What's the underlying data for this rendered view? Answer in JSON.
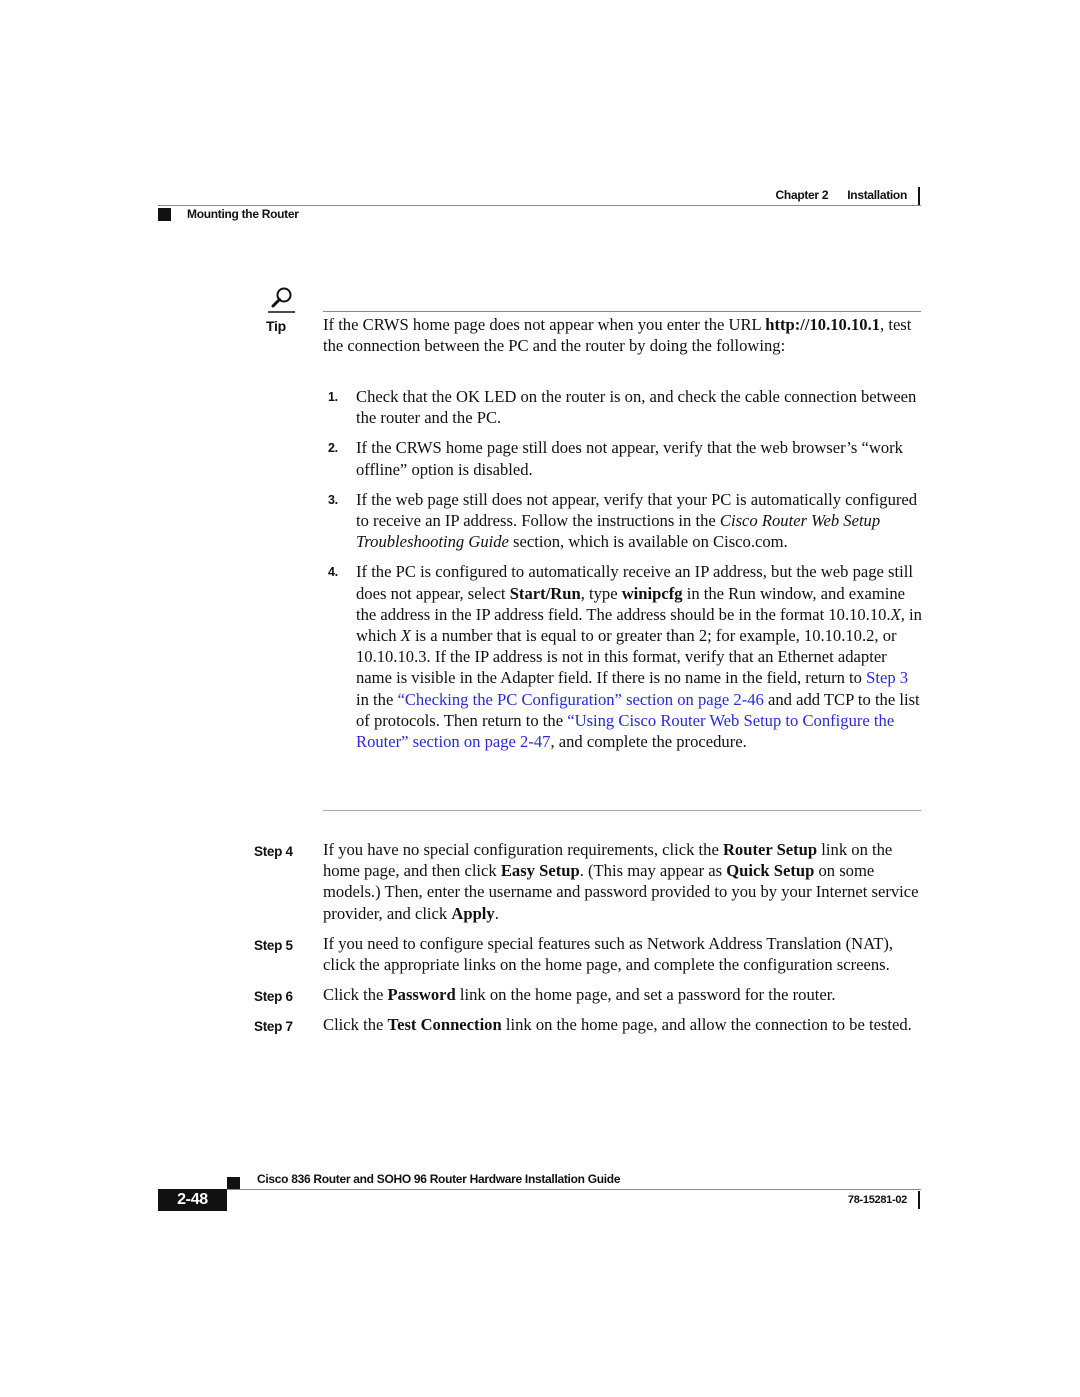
{
  "header": {
    "chapter_label": "Chapter 2",
    "chapter_title": "Installation",
    "section_title": "Mounting the Router"
  },
  "tip": {
    "icon": "magnifier-icon",
    "label": "Tip",
    "intro_1": "If the CRWS home page does not appear when you enter the URL",
    "intro_url": "http://10.10.10.1",
    "intro_2": ", test the connection between the PC and the router by doing the following:",
    "items": [
      {
        "number": "1.",
        "text": "Check that the OK LED on the router is on, and check the cable connection between the router and the PC."
      },
      {
        "number": "2.",
        "text": "If the CRWS home page still does not appear, verify that the web browser’s “work offline” option is disabled."
      },
      {
        "number": "3.",
        "text_1": "If the web page still does not appear, verify that your PC is automatically configured to receive an IP address. Follow the instructions in the ",
        "text_italic": "Cisco Router Web Setup Troubleshooting Guide",
        "text_2": " section, which is available on Cisco.com."
      },
      {
        "number": "4.",
        "t1": "If the PC is configured to automatically receive an IP address, but the web page still does not appear, select ",
        "b1": "Start/Run",
        "t2": ", type ",
        "b2": "winipcfg",
        "t3": " in the Run window, and examine the address in the IP address field. The address should be in the format 10.10.10.",
        "i1": "X,",
        "t4": " in which ",
        "i2": "X",
        "t5": " is a number that is equal to or greater than 2; for example, 10.10.10.2, or 10.10.10.3. If the IP address is not in this format, verify that an Ethernet adapter name is visible in the Adapter field. If there is no name in the field, return to ",
        "link1": "Step 3",
        "t6": " in the ",
        "link2": "“Checking the PC Configuration” section on page 2-46",
        "t7": " and add TCP to the list of protocols. Then return to the ",
        "link3": "“Using Cisco Router Web Setup to Configure the Router” section on page 2-47",
        "t8": ", and complete the procedure."
      }
    ]
  },
  "steps": [
    {
      "label": "Step 4",
      "t1": "If you have no special configuration requirements, click the ",
      "b1": "Router Setup",
      "t2": " link on the home page, and then click ",
      "b2": "Easy Setup",
      "t3": ". (This may appear as ",
      "b3": "Quick Setup",
      "t4": " on some models.) Then, enter the username and password provided to you by your Internet service provider, and click ",
      "b4": "Apply",
      "t5": "."
    },
    {
      "label": "Step 5",
      "text": "If you need to configure special features such as Network Address Translation (NAT), click the appropriate links on the home page, and complete the configuration screens."
    },
    {
      "label": "Step 6",
      "t1": "Click the ",
      "b1": "Password",
      "t2": " link on the home page, and set a password for the router."
    },
    {
      "label": "Step 7",
      "t1": "Click the ",
      "b1": "Test Connection",
      "t2": " link on the home page, and allow the connection to be tested."
    }
  ],
  "footer": {
    "guide_title": "Cisco 836 Router and SOHO 96 Router Hardware Installation Guide",
    "page_number": "2-48",
    "doc_number": "78-15281-02"
  },
  "colors": {
    "link": "#2a2ad8",
    "text": "#111111"
  }
}
